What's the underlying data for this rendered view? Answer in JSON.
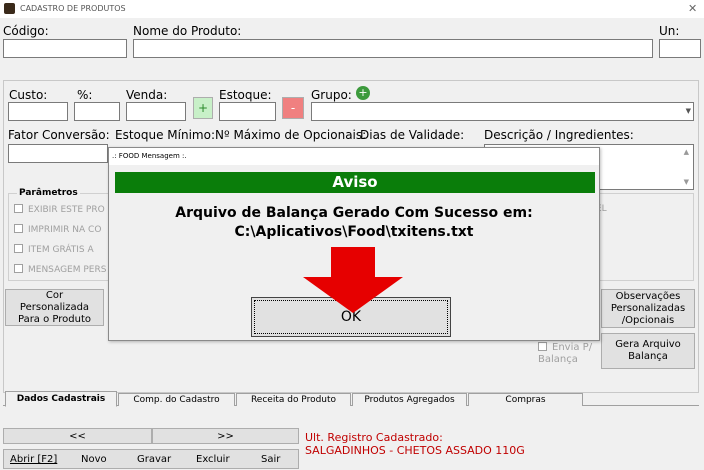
{
  "window": {
    "title": "CADASTRO DE PRODUTOS",
    "close_glyph": "✕"
  },
  "fields": {
    "codigo": "Código:",
    "nome": "Nome do Produto:",
    "un": "Un:",
    "custo": "Custo:",
    "percent": "%:",
    "venda": "Venda:",
    "estoque": "Estoque:",
    "plus": "+",
    "minus": "-",
    "grupo": "Grupo:",
    "fator": "Fator Conversão:",
    "estoque_min": "Estoque Mínimo:",
    "max_opc": "Nº Máximo de Opcionais:",
    "validade": "Dias de Validade:",
    "descricao": "Descrição / Ingredientes:"
  },
  "params": {
    "title": "Parâmetros",
    "items": [
      "EXIBIR ESTE PRO",
      "IMPRIMIR NA CO",
      "ITEM GRÁTIS A",
      "MENSAGEM PERS"
    ],
    "right_text": "EL"
  },
  "buttons": {
    "cor": "Cor Personalizada Para o Produto",
    "obs": "Observações Personalizadas /Opcionais",
    "gera": "Gera Arquivo Balança",
    "envia": "Envia P/ Balança"
  },
  "tabs": [
    "Dados Cadastrais",
    "Comp. do Cadastro",
    "Receita do Produto",
    "Produtos Agregados",
    "Compras"
  ],
  "nav": {
    "prev": "<<",
    "next": ">>"
  },
  "actions": [
    "Abrir [F2]",
    "Novo",
    "Gravar",
    "Excluir",
    "Sair"
  ],
  "last": {
    "label": "Ult. Registro Cadastrado:",
    "value": "SALGADINHOS - CHETOS ASSADO 110G"
  },
  "dialog": {
    "title": ".: FOOD Mensagem :.",
    "header": "Aviso",
    "message": "Arquivo de Balança Gerado Com Sucesso em:",
    "path": "C:\\Aplicativos\\Food\\txitens.txt",
    "ok": "OK"
  },
  "colors": {
    "dialog_header": "#0a7d0a",
    "arrow": "#e60000",
    "last_text": "#c00000",
    "plus_bg": "#c8f0c8",
    "minus_bg": "#f08080"
  }
}
